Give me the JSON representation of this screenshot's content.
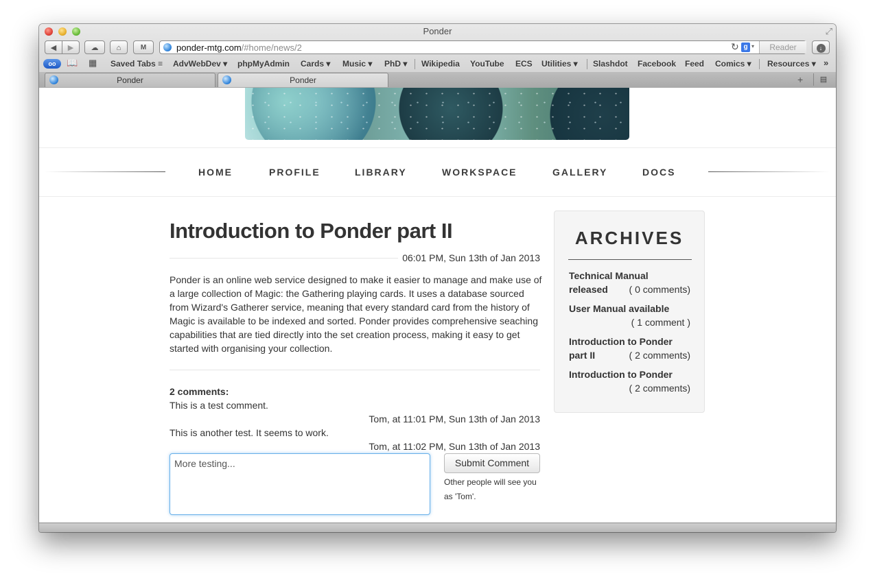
{
  "window": {
    "title": "Ponder"
  },
  "toolbar": {
    "back_icon": "◀",
    "forward_icon": "▶",
    "cloud_icon": "☁",
    "home_icon": "⌂",
    "ext_label": "M",
    "reader_label": "Reader",
    "download_icon": "↓"
  },
  "address": {
    "domain": "ponder-mtg.com",
    "path": "/#home/news/2",
    "reload_icon": "↻",
    "search_engine": "g"
  },
  "bookmarks": [
    {
      "label": "Saved Tabs ≡"
    },
    {
      "label": "AdvWebDev ▾"
    },
    {
      "label": "phpMyAdmin"
    },
    {
      "label": "Cards ▾"
    },
    {
      "label": "Music ▾"
    },
    {
      "label": "PhD ▾"
    },
    {
      "label": "Wikipedia"
    },
    {
      "label": "YouTube"
    },
    {
      "label": "ECS"
    },
    {
      "label": "Utilities ▾"
    },
    {
      "label": "Slashdot"
    },
    {
      "label": "Facebook"
    },
    {
      "label": "Feed"
    },
    {
      "label": "Comics ▾"
    },
    {
      "label": "Resources ▾"
    }
  ],
  "bookmarks_more": "»",
  "tabs": [
    {
      "label": "Ponder"
    },
    {
      "label": "Ponder"
    }
  ],
  "tabs_add": "+",
  "nav": [
    {
      "label": "HOME"
    },
    {
      "label": "PROFILE"
    },
    {
      "label": "LIBRARY"
    },
    {
      "label": "WORKSPACE"
    },
    {
      "label": "GALLERY"
    },
    {
      "label": "DOCS"
    }
  ],
  "article": {
    "title": "Introduction to Ponder part II",
    "date": "06:01 PM, Sun 13th of Jan 2013",
    "body": "Ponder is an online web service designed to make it easier to manage and make use of a large collection of Magic: the Gathering playing cards. It uses a database sourced from Wizard's Gatherer service, meaning that every standard card from the history of Magic is available to be indexed and sorted. Ponder provides comprehensive seaching capabilities that are tied directly into the set creation process, making it easy to get started with organising your collection."
  },
  "comments": {
    "heading": "2 comments:",
    "items": [
      {
        "text": "This is a test comment.",
        "meta": "Tom, at 11:01 PM, Sun 13th of Jan 2013"
      },
      {
        "text": "This is another test. It seems to work.",
        "meta": "Tom, at 11:02 PM, Sun 13th of Jan 2013"
      }
    ],
    "input_value": "More testing...",
    "submit_label": "Submit Comment",
    "note": "Other people will see you as 'Tom'."
  },
  "archives": {
    "title": "ARCHIVES",
    "items": [
      {
        "title_line1": "Technical Manual",
        "title_line2": "released",
        "count": "( 0 comments)"
      },
      {
        "title_line1": "User Manual available",
        "title_line2": "",
        "count": "( 1 comment )"
      },
      {
        "title_line1": "Introduction to Ponder",
        "title_line2": "part II",
        "count": "( 2 comments)"
      },
      {
        "title_line1": "Introduction to Ponder",
        "title_line2": "",
        "count": "( 2 comments)"
      }
    ]
  }
}
